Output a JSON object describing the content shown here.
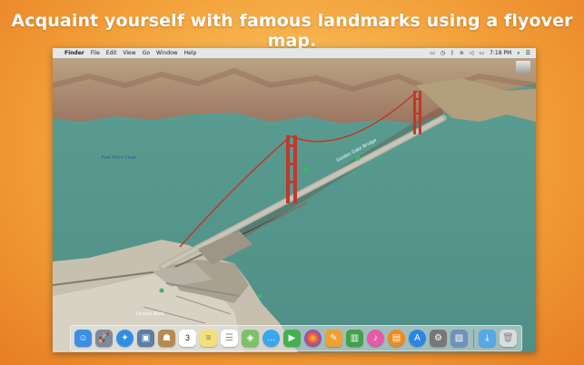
{
  "banner": {
    "text": "Acquaint yourself with famous landmarks using a flyover map."
  },
  "menubar": {
    "apple": "",
    "items": [
      "Finder",
      "File",
      "Edit",
      "View",
      "Go",
      "Window",
      "Help"
    ],
    "clock": "7:18 PM"
  },
  "map": {
    "labels": {
      "fort_point": "Fort Point Chan",
      "bridge": "Golden Gate Bridge",
      "bottom": "Lincoln Blvd"
    }
  },
  "dock": {
    "apps": [
      {
        "name": "Finder",
        "icon": "finder-icon",
        "color": "#3a8ee6"
      },
      {
        "name": "Launchpad",
        "icon": "launchpad-icon",
        "color": "#7f8a99"
      },
      {
        "name": "Safari",
        "icon": "safari-icon",
        "color": "#2f8fe8"
      },
      {
        "name": "Photo Booth",
        "icon": "photo-icon",
        "color": "#5b7fa6"
      },
      {
        "name": "Contacts",
        "icon": "contacts-icon",
        "color": "#b88a4f"
      },
      {
        "name": "Calendar",
        "icon": "calendar-icon",
        "color": "#ffffff"
      },
      {
        "name": "Notes",
        "icon": "notes-icon",
        "color": "#f4e07a"
      },
      {
        "name": "Reminders",
        "icon": "reminders-icon",
        "color": "#ffffff"
      },
      {
        "name": "Maps",
        "icon": "maps-icon",
        "color": "#7ec06a"
      },
      {
        "name": "Messages",
        "icon": "messages-icon",
        "color": "#3aa6f0"
      },
      {
        "name": "FaceTime",
        "icon": "facetime-icon",
        "color": "#45b04e"
      },
      {
        "name": "Photos",
        "icon": "photos-icon",
        "color": "#ffffff"
      },
      {
        "name": "Pages",
        "icon": "pages-icon",
        "color": "#f0a030"
      },
      {
        "name": "Numbers",
        "icon": "numbers-icon",
        "color": "#43a047"
      },
      {
        "name": "iTunes",
        "icon": "itunes-icon",
        "color": "#e45aa8"
      },
      {
        "name": "iBooks",
        "icon": "ibooks-icon",
        "color": "#f08a1c"
      },
      {
        "name": "App Store",
        "icon": "appstore-icon",
        "color": "#2a86e4"
      },
      {
        "name": "System Preferences",
        "icon": "gear-icon",
        "color": "#777777"
      },
      {
        "name": "Preview",
        "icon": "preview-icon",
        "color": "#6c93b8"
      }
    ],
    "trash_group": [
      {
        "name": "Downloads",
        "icon": "folder-icon",
        "color": "#56a9e6"
      },
      {
        "name": "Trash",
        "icon": "trash-icon",
        "color": "#d9dde0"
      }
    ]
  }
}
